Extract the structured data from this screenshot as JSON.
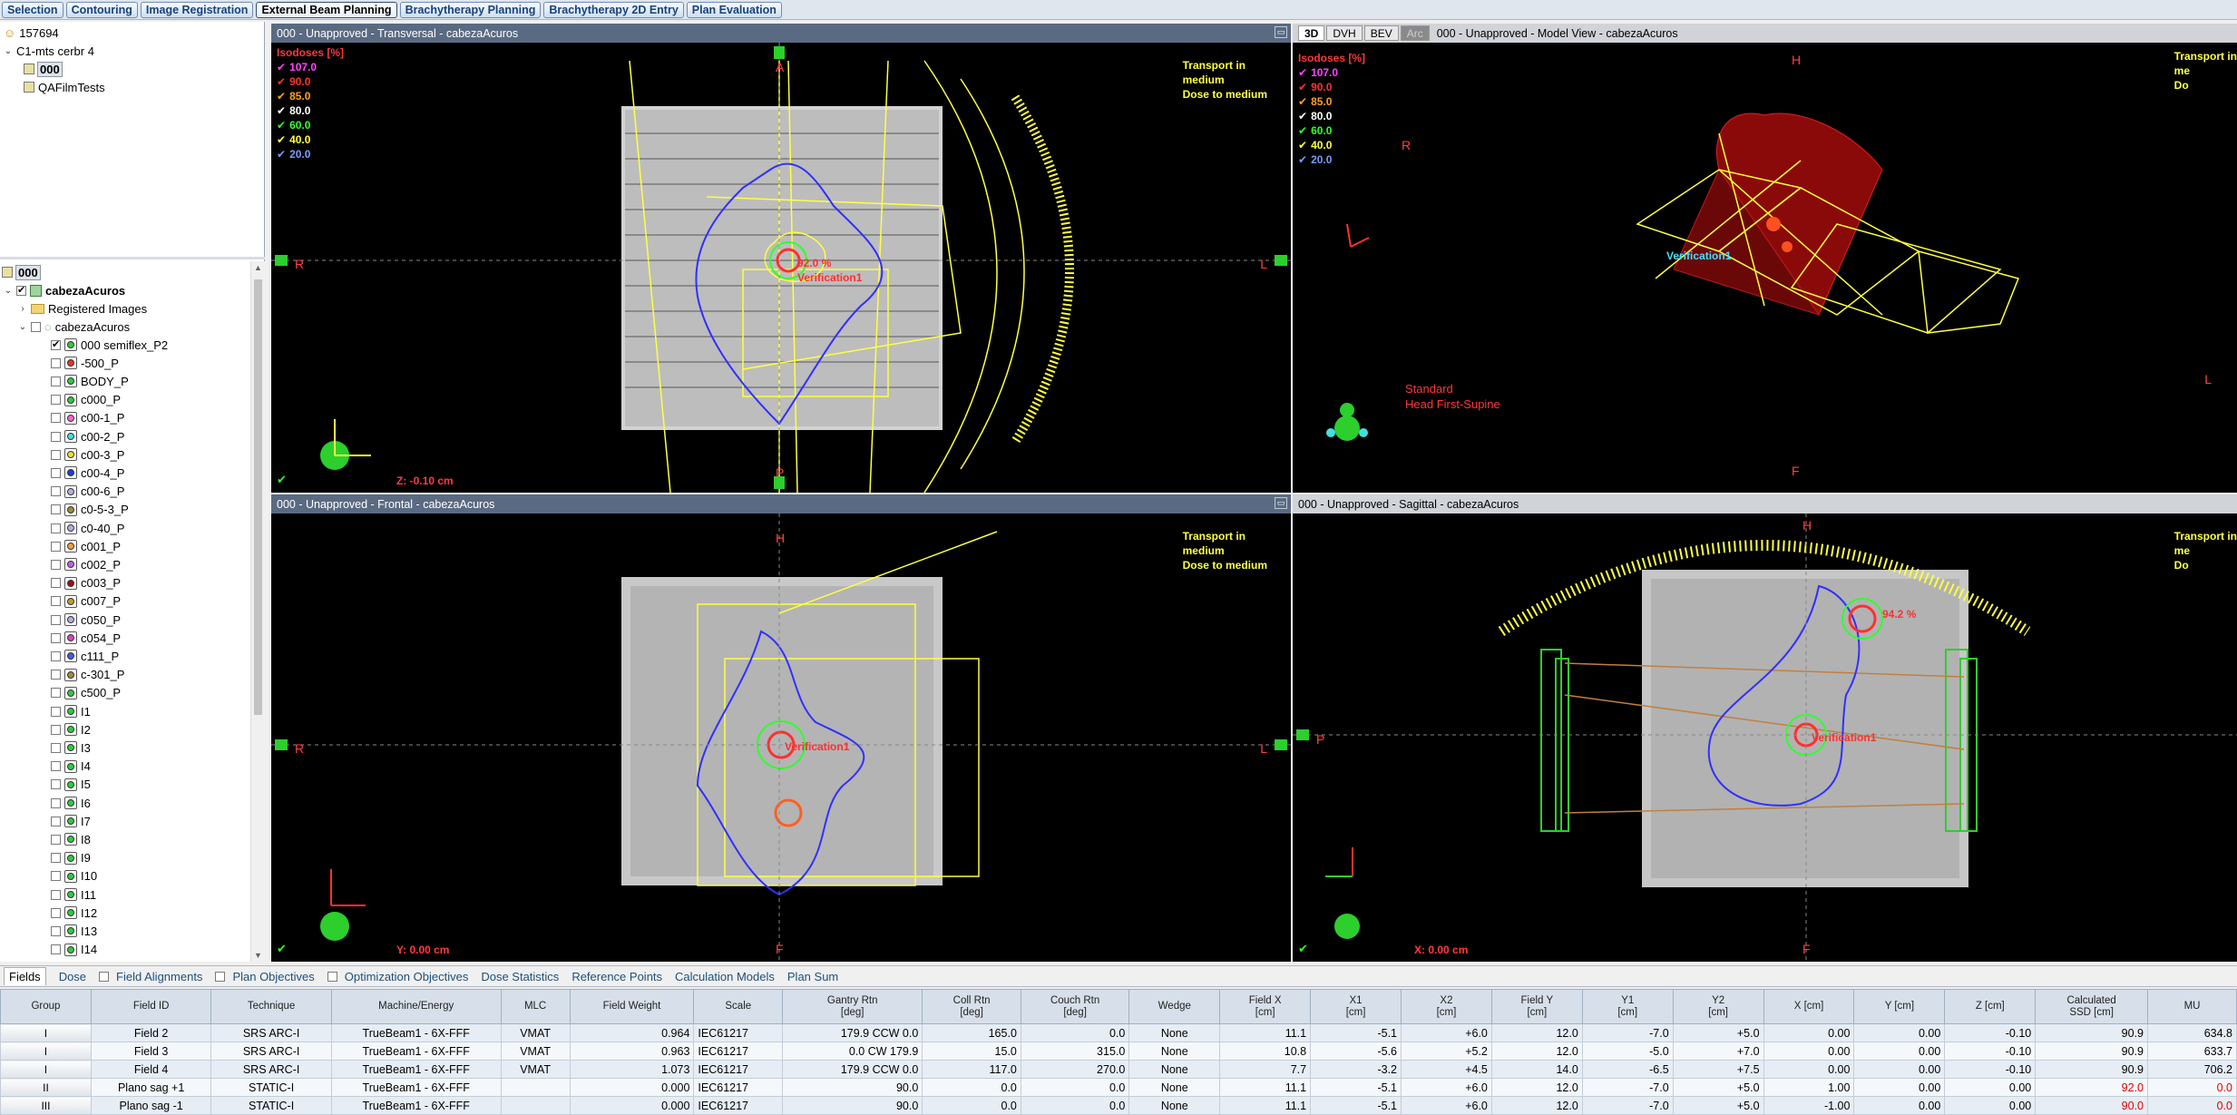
{
  "workspaces": [
    "Selection",
    "Contouring",
    "Image Registration",
    "External Beam Planning",
    "Brachytherapy Planning",
    "Brachytherapy 2D Entry",
    "Plan Evaluation"
  ],
  "active_workspace": "External Beam Planning",
  "patient_tree": {
    "patient_id": "157694",
    "course": "C1-mts cerbr 4",
    "plan": "000",
    "qa": "QAFilmTests"
  },
  "structure_tree": {
    "plan": "000",
    "image": "cabezaAcuros",
    "registered": "Registered Images",
    "structure_set": "cabezaAcuros",
    "structures": [
      {
        "name": "000 semiflex_P2",
        "color": "#2ecc40",
        "on": true
      },
      {
        "name": "-500_P",
        "color": "#e8322d",
        "on": false
      },
      {
        "name": "BODY_P",
        "color": "#2ecc40",
        "on": false
      },
      {
        "name": "c000_P",
        "color": "#2ecc40",
        "on": false
      },
      {
        "name": "c00-1_P",
        "color": "#ff66cc",
        "on": false
      },
      {
        "name": "c00-2_P",
        "color": "#40e0e0",
        "on": false
      },
      {
        "name": "c00-3_P",
        "color": "#f0e020",
        "on": false
      },
      {
        "name": "c00-4_P",
        "color": "#2040d0",
        "on": false
      },
      {
        "name": "c00-6_P",
        "color": "#b0b0e8",
        "on": false
      },
      {
        "name": "c0-5-3_P",
        "color": "#a08c3a",
        "on": false
      },
      {
        "name": "c0-40_P",
        "color": "#b0b0e8",
        "on": false
      },
      {
        "name": "c001_P",
        "color": "#f0a040",
        "on": false
      },
      {
        "name": "c002_P",
        "color": "#c060e0",
        "on": false
      },
      {
        "name": "c003_P",
        "color": "#a01010",
        "on": false
      },
      {
        "name": "c007_P",
        "color": "#c0a020",
        "on": false
      },
      {
        "name": "c050_P",
        "color": "#b0b0e8",
        "on": false
      },
      {
        "name": "c054_P",
        "color": "#e040c0",
        "on": false
      },
      {
        "name": "c111_P",
        "color": "#4060e0",
        "on": false
      },
      {
        "name": "c-301_P",
        "color": "#a08c3a",
        "on": false
      },
      {
        "name": "c500_P",
        "color": "#2ecc40",
        "on": false
      },
      {
        "name": "I1",
        "color": "#2ecc40",
        "on": false
      },
      {
        "name": "I2",
        "color": "#2ecc40",
        "on": false
      },
      {
        "name": "I3",
        "color": "#2ecc40",
        "on": false
      },
      {
        "name": "I4",
        "color": "#2ecc40",
        "on": false
      },
      {
        "name": "I5",
        "color": "#2ecc40",
        "on": false
      },
      {
        "name": "I6",
        "color": "#2ecc40",
        "on": false
      },
      {
        "name": "I7",
        "color": "#2ecc40",
        "on": false
      },
      {
        "name": "I8",
        "color": "#2ecc40",
        "on": false
      },
      {
        "name": "I9",
        "color": "#2ecc40",
        "on": false
      },
      {
        "name": "I10",
        "color": "#2ecc40",
        "on": false
      },
      {
        "name": "I11",
        "color": "#2ecc40",
        "on": false
      },
      {
        "name": "I12",
        "color": "#2ecc40",
        "on": false
      },
      {
        "name": "I13",
        "color": "#2ecc40",
        "on": false
      },
      {
        "name": "I14",
        "color": "#2ecc40",
        "on": false
      }
    ]
  },
  "isodoses": {
    "title": "Isodoses [%]",
    "levels": [
      {
        "value": "107.0",
        "color": "#ff44ff",
        "check": true
      },
      {
        "value": "90.0",
        "color": "#ff3030",
        "check": true
      },
      {
        "value": "85.0",
        "color": "#ffa020",
        "check": true
      },
      {
        "value": "80.0",
        "color": "#ffffff",
        "check": true
      },
      {
        "value": "60.0",
        "color": "#30ff30",
        "check": true
      },
      {
        "value": "40.0",
        "color": "#ffff40",
        "check": true
      },
      {
        "value": "20.0",
        "color": "#7a9aff",
        "check": true
      }
    ]
  },
  "dose_note": [
    "Transport in",
    "medium",
    "Dose to medium"
  ],
  "dose_note_cut": [
    "Transport in",
    "me",
    "Do"
  ],
  "viewers": {
    "transversal": {
      "title": "000  -  Unapproved - Transversal - cabezaAcuros",
      "coord": "Z: -0.10 cm",
      "point_label": "92.0 %",
      "field_label": "Verification1",
      "orient_r": "R",
      "orient_l": "L",
      "orient_a": "A",
      "orient_p": "P"
    },
    "model": {
      "tabs": [
        "3D",
        "DVH",
        "BEV",
        "Arc"
      ],
      "title": "000  -  Unapproved - Model View - cabezaAcuros",
      "orient_h": "H",
      "orient_f": "F",
      "orient_r": "R",
      "orient_l": "L",
      "position": "Standard",
      "orientation": "Head First-Supine",
      "field_label": "Verification1"
    },
    "frontal": {
      "title": "000  -  Unapproved - Frontal - cabezaAcuros",
      "coord": "Y: 0.00 cm",
      "field_label": "Verification1",
      "orient_r": "R",
      "orient_l": "L",
      "orient_h": "H",
      "orient_f": "F"
    },
    "sagittal": {
      "title": "000  -  Unapproved - Sagittal - cabezaAcuros",
      "coord": "X: 0.00 cm",
      "point_label": "94.2 %",
      "field_label": "Verification1",
      "orient_p": "P",
      "orient_h": "H",
      "orient_f": "F"
    }
  },
  "field_tabs": [
    {
      "label": "Fields",
      "cb": false,
      "active": true
    },
    {
      "label": "Dose",
      "cb": false
    },
    {
      "label": "Field Alignments",
      "cb": true
    },
    {
      "label": "Plan Objectives",
      "cb": true
    },
    {
      "label": "Optimization Objectives",
      "cb": true
    },
    {
      "label": "Dose Statistics",
      "cb": false
    },
    {
      "label": "Reference Points",
      "cb": false
    },
    {
      "label": "Calculation Models",
      "cb": false
    },
    {
      "label": "Plan Sum",
      "cb": false
    }
  ],
  "fields_table": {
    "columns": [
      "Group",
      "Field ID",
      "Technique",
      "Machine/Energy",
      "MLC",
      "Field Weight",
      "Scale",
      "Gantry Rtn\n[deg]",
      "Coll Rtn\n[deg]",
      "Couch Rtn\n[deg]",
      "Wedge",
      "Field X\n[cm]",
      "X1\n[cm]",
      "X2\n[cm]",
      "Field Y\n[cm]",
      "Y1\n[cm]",
      "Y2\n[cm]",
      "X [cm]",
      "Y [cm]",
      "Z [cm]",
      "Calculated\nSSD [cm]",
      "MU"
    ],
    "rows": [
      [
        "I",
        "Field 2",
        "SRS ARC-I",
        "TrueBeam1 - 6X-FFF",
        "VMAT",
        "0.964",
        "IEC61217",
        "179.9 CCW 0.0",
        "165.0",
        "0.0",
        "None",
        "11.1",
        "-5.1",
        "+6.0",
        "12.0",
        "-7.0",
        "+5.0",
        "0.00",
        "0.00",
        "-0.10",
        "90.9",
        "634.8"
      ],
      [
        "I",
        "Field 3",
        "SRS ARC-I",
        "TrueBeam1 - 6X-FFF",
        "VMAT",
        "0.963",
        "IEC61217",
        "0.0 CW 179.9",
        "15.0",
        "315.0",
        "None",
        "10.8",
        "-5.6",
        "+5.2",
        "12.0",
        "-5.0",
        "+7.0",
        "0.00",
        "0.00",
        "-0.10",
        "90.9",
        "633.7"
      ],
      [
        "I",
        "Field 4",
        "SRS ARC-I",
        "TrueBeam1 - 6X-FFF",
        "VMAT",
        "1.073",
        "IEC61217",
        "179.9 CCW 0.0",
        "117.0",
        "270.0",
        "None",
        "7.7",
        "-3.2",
        "+4.5",
        "14.0",
        "-6.5",
        "+7.5",
        "0.00",
        "0.00",
        "-0.10",
        "90.9",
        "706.2"
      ],
      [
        "II",
        "Plano sag +1",
        "STATIC-I",
        "TrueBeam1 - 6X-FFF",
        "",
        "0.000",
        "IEC61217",
        "90.0",
        "0.0",
        "0.0",
        "None",
        "11.1",
        "-5.1",
        "+6.0",
        "12.0",
        "-7.0",
        "+5.0",
        "1.00",
        "0.00",
        "0.00",
        "92.0",
        "0.0"
      ],
      [
        "III",
        "Plano sag -1",
        "STATIC-I",
        "TrueBeam1 - 6X-FFF",
        "",
        "0.000",
        "IEC61217",
        "90.0",
        "0.0",
        "0.0",
        "None",
        "11.1",
        "-5.1",
        "+6.0",
        "12.0",
        "-7.0",
        "+5.0",
        "-1.00",
        "0.00",
        "0.00",
        "90.0",
        "0.0"
      ]
    ]
  }
}
